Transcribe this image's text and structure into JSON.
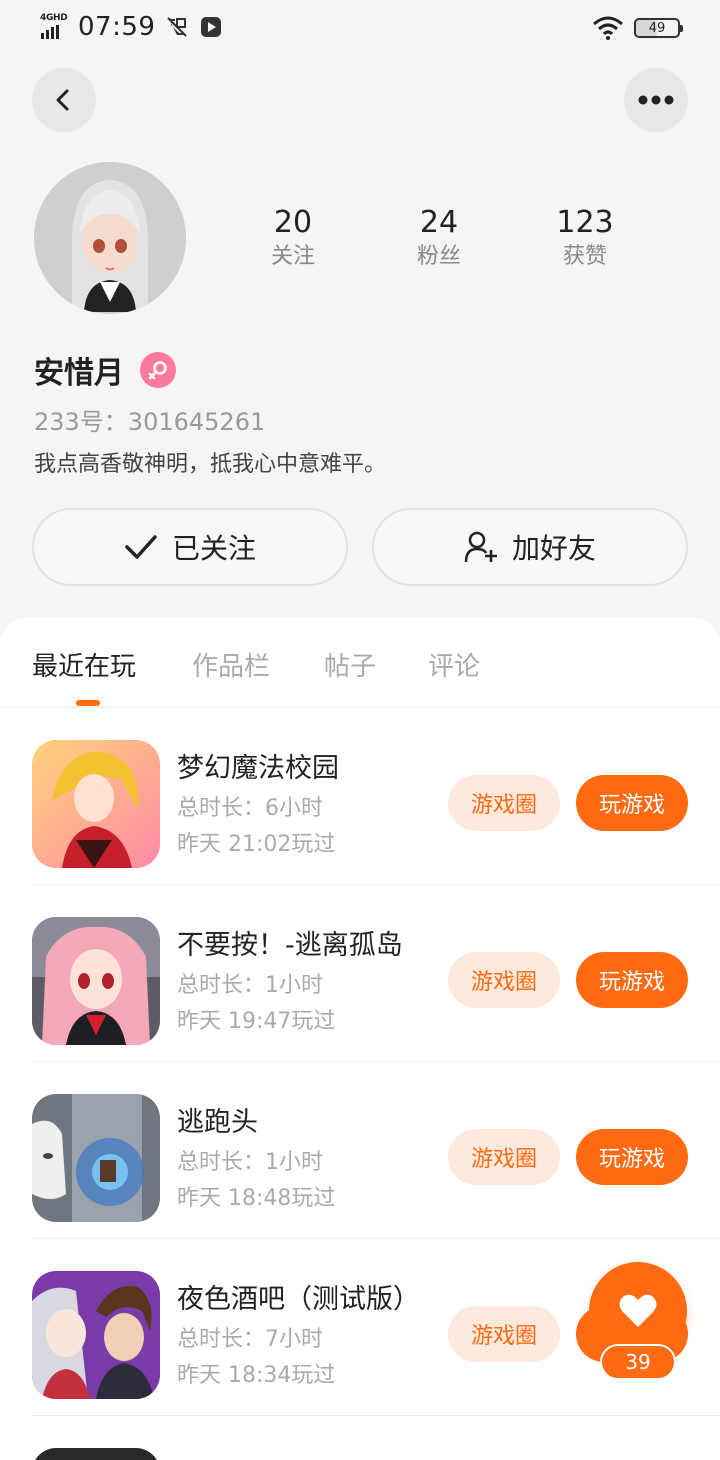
{
  "status_bar": {
    "network": "4GHD",
    "time": "07:59",
    "battery": "49"
  },
  "header": {
    "back_icon": "chevron-left-icon",
    "more_icon": "more-dots-icon"
  },
  "profile": {
    "name": "安惜月",
    "gender_icon": "female-icon",
    "id_label": "233号：301645261",
    "bio": "我点高香敬神明，抵我心中意难平。",
    "stats": [
      {
        "value": "20",
        "label": "关注"
      },
      {
        "value": "24",
        "label": "粉丝"
      },
      {
        "value": "123",
        "label": "获赞"
      }
    ]
  },
  "actions": {
    "follow_label": "已关注",
    "add_friend_label": "加好友"
  },
  "tabs": [
    {
      "label": "最近在玩",
      "active": true
    },
    {
      "label": "作品栏",
      "active": false
    },
    {
      "label": "帖子",
      "active": false
    },
    {
      "label": "评论",
      "active": false
    }
  ],
  "games": [
    {
      "title": "梦幻魔法校园",
      "duration": "总时长：6小时",
      "last_played": "昨天 21:02玩过",
      "circle_label": "游戏圈",
      "play_label": "玩游戏"
    },
    {
      "title": "不要按！-逃离孤岛",
      "duration": "总时长：1小时",
      "last_played": "昨天 19:47玩过",
      "circle_label": "游戏圈",
      "play_label": "玩游戏"
    },
    {
      "title": "逃跑头",
      "duration": "总时长：1小时",
      "last_played": "昨天 18:48玩过",
      "circle_label": "游戏圈",
      "play_label": "玩游戏"
    },
    {
      "title": "夜色酒吧（测试版）",
      "duration": "总时长：7小时",
      "last_played": "昨天 18:34玩过",
      "circle_label": "游戏圈",
      "play_label": "玩游戏"
    }
  ],
  "like_button": {
    "count": "39",
    "icon": "heart-icon"
  },
  "colors": {
    "accent": "#ff6a13",
    "accent_light": "#ffe9dc",
    "gender": "#ff7a9c"
  }
}
